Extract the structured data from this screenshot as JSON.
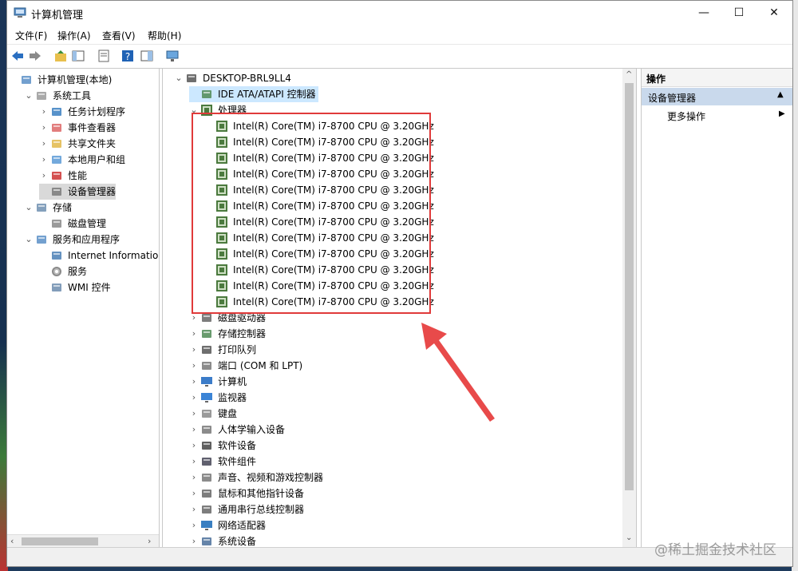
{
  "window": {
    "title": "计算机管理",
    "minimize": "—",
    "maximize": "☐",
    "close": "✕"
  },
  "menu": [
    "文件(F)",
    "操作(A)",
    "查看(V)",
    "帮助(H)"
  ],
  "toolbar_icons": [
    "back-icon",
    "forward-icon",
    "folder-up-icon",
    "show-tree-icon",
    "properties-icon",
    "help-icon",
    "console-tree-icon",
    "monitor-icon"
  ],
  "left_tree": [
    {
      "label": "计算机管理(本地)",
      "icon": "computer-manage-icon",
      "expander": "",
      "level": 0
    },
    {
      "label": "系统工具",
      "icon": "tools-icon",
      "expander": "⌄",
      "level": 1
    },
    {
      "label": "任务计划程序",
      "icon": "clock-icon",
      "expander": "›",
      "level": 2
    },
    {
      "label": "事件查看器",
      "icon": "event-viewer-icon",
      "expander": "›",
      "level": 2
    },
    {
      "label": "共享文件夹",
      "icon": "shared-folder-icon",
      "expander": "›",
      "level": 2
    },
    {
      "label": "本地用户和组",
      "icon": "users-icon",
      "expander": "›",
      "level": 2
    },
    {
      "label": "性能",
      "icon": "performance-icon",
      "expander": "›",
      "level": 2
    },
    {
      "label": "设备管理器",
      "icon": "device-manager-icon",
      "expander": "",
      "level": 2,
      "selected": true
    },
    {
      "label": "存储",
      "icon": "storage-icon",
      "expander": "⌄",
      "level": 1
    },
    {
      "label": "磁盘管理",
      "icon": "disk-icon",
      "expander": "",
      "level": 2
    },
    {
      "label": "服务和应用程序",
      "icon": "services-apps-icon",
      "expander": "⌄",
      "level": 1
    },
    {
      "label": "Internet Information S",
      "icon": "iis-icon",
      "expander": "",
      "level": 2
    },
    {
      "label": "服务",
      "icon": "gear-icon",
      "expander": "",
      "level": 2
    },
    {
      "label": "WMI 控件",
      "icon": "wmi-icon",
      "expander": "",
      "level": 2
    }
  ],
  "device_tree": {
    "root": "DESKTOP-BRL9LL4",
    "ide_label": "IDE ATA/ATAPI 控制器",
    "processors_label": "处理器",
    "cpus": [
      "Intel(R) Core(TM) i7-8700 CPU @ 3.20GHz",
      "Intel(R) Core(TM) i7-8700 CPU @ 3.20GHz",
      "Intel(R) Core(TM) i7-8700 CPU @ 3.20GHz",
      "Intel(R) Core(TM) i7-8700 CPU @ 3.20GHz",
      "Intel(R) Core(TM) i7-8700 CPU @ 3.20GHz",
      "Intel(R) Core(TM) i7-8700 CPU @ 3.20GHz",
      "Intel(R) Core(TM) i7-8700 CPU @ 3.20GHz",
      "Intel(R) Core(TM) i7-8700 CPU @ 3.20GHz",
      "Intel(R) Core(TM) i7-8700 CPU @ 3.20GHz",
      "Intel(R) Core(TM) i7-8700 CPU @ 3.20GHz",
      "Intel(R) Core(TM) i7-8700 CPU @ 3.20GHz",
      "Intel(R) Core(TM) i7-8700 CPU @ 3.20GHz"
    ],
    "categories": [
      {
        "label": "磁盘驱动器",
        "icon": "disk-drive-icon"
      },
      {
        "label": "存储控制器",
        "icon": "storage-controller-icon"
      },
      {
        "label": "打印队列",
        "icon": "printer-icon"
      },
      {
        "label": "端口 (COM 和 LPT)",
        "icon": "port-icon"
      },
      {
        "label": "计算机",
        "icon": "computer-icon"
      },
      {
        "label": "监视器",
        "icon": "monitor-icon"
      },
      {
        "label": "键盘",
        "icon": "keyboard-icon"
      },
      {
        "label": "人体学输入设备",
        "icon": "hid-icon"
      },
      {
        "label": "软件设备",
        "icon": "software-device-icon"
      },
      {
        "label": "软件组件",
        "icon": "software-component-icon"
      },
      {
        "label": "声音、视频和游戏控制器",
        "icon": "sound-icon"
      },
      {
        "label": "鼠标和其他指针设备",
        "icon": "mouse-icon"
      },
      {
        "label": "通用串行总线控制器",
        "icon": "usb-icon"
      },
      {
        "label": "网络适配器",
        "icon": "network-adapter-icon"
      },
      {
        "label": "系统设备",
        "icon": "system-device-icon"
      }
    ]
  },
  "actions_pane": {
    "header": "操作",
    "section": "设备管理器",
    "more": "更多操作"
  },
  "watermark": "@稀土掘金技术社区",
  "colors": {
    "highlight_box": "#e03a3a",
    "selected_section": "#c9d9ec"
  }
}
